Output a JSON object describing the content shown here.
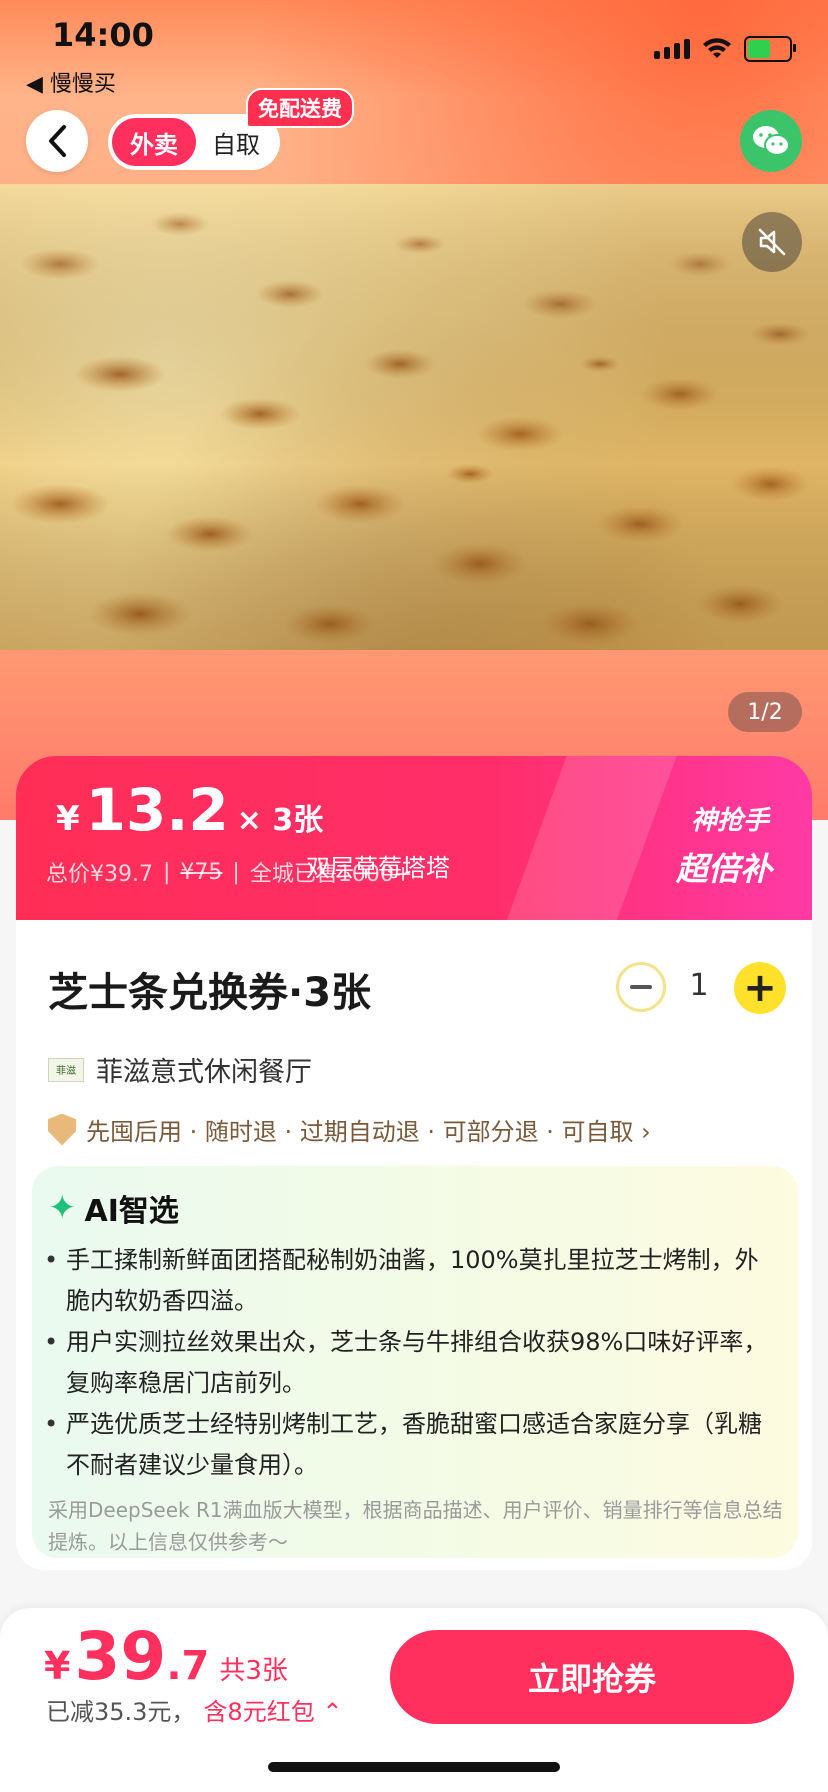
{
  "status_bar": {
    "time": "14:00",
    "back_app": "◀ 慢慢买"
  },
  "header": {
    "delivery_tab": "外卖",
    "pickup_tab": "自取",
    "free_delivery_badge": "免配送费"
  },
  "media": {
    "pager": "1/2"
  },
  "price_banner": {
    "currency": "¥",
    "unit_price": "13.2",
    "unit_suffix": "× 3张",
    "total_text": "总价¥39.7",
    "original_price": "¥75",
    "city_sales": "全城已售1000+",
    "overlay_caption": "双层草莓塔塔",
    "tag_line1": "神抢手",
    "tag_line2": "超倍补"
  },
  "product": {
    "title": "芝士条兑换券·3张",
    "quantity": "1",
    "store_logo_text": "菲滋",
    "store_name": "菲滋意式休闲餐厅",
    "policy": "先囤后用 · 随时退 · 过期自动退 · 可部分退 · 可自取 ›"
  },
  "ai": {
    "title": "AI智选",
    "items": [
      "手工揉制新鲜面团搭配秘制奶油酱，100%莫扎里拉芝士烤制，外脆内软奶香四溢。",
      "用户实测拉丝效果出众，芝士条与牛排组合收获98%口味好评率，复购率稳居门店前列。",
      "严选优质芝士经特别烤制工艺，香脆甜蜜口感适合家庭分享（乳糖不耐者建议少量食用）。"
    ],
    "note": "采用DeepSeek R1满血版大模型，根据商品描述、用户评价、销量排行等信息总结提炼。以上信息仅供参考～"
  },
  "bottom_bar": {
    "currency": "¥",
    "total_int": "39",
    "total_dec": ".7",
    "count": "共3张",
    "saved": "已减35.3元，",
    "red_packet": "含8元红包 ⌃",
    "buy_label": "立即抢券"
  },
  "colors": {
    "accent": "#ff2f5e",
    "plus_button": "#ffe12b",
    "wechat": "#3cc46b"
  }
}
